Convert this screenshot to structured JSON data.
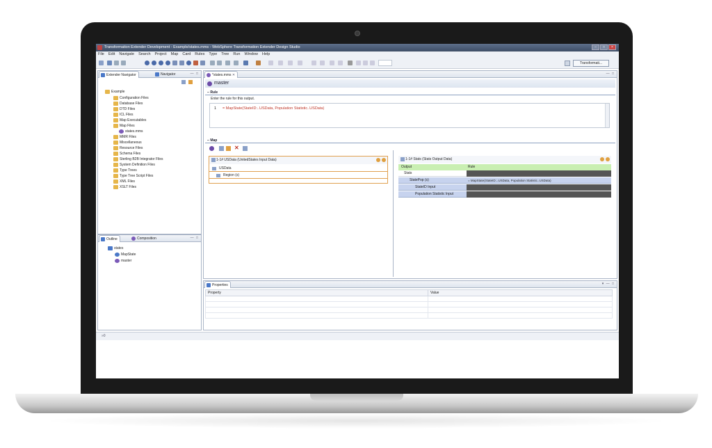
{
  "window": {
    "title": "Transformation Extender Development - Example/states.mms - WebSphere Transformation Extender Design Studio"
  },
  "menu": [
    "File",
    "Edit",
    "Navigate",
    "Search",
    "Project",
    "Map",
    "Card",
    "Rules",
    "Type",
    "Tree",
    "Run",
    "Window",
    "Help"
  ],
  "toolbar": {
    "perspective_label": "Transformati..."
  },
  "navigator": {
    "tabs": [
      "Extender Navigator",
      "Navigator"
    ],
    "root": "Example",
    "items": [
      "Configuration Files",
      "Database Files",
      "DTD Files",
      "ICL Files",
      "Map Executables",
      "Map Files",
      "states.mms",
      "MMR Files",
      "Miscellaneous",
      "Resource Files",
      "Schema Files",
      "Sterling B2B Integrator Files",
      "System Definition Files",
      "Type Trees",
      "Type Tree Script Files",
      "XML Files",
      "XSLT Files"
    ]
  },
  "outline": {
    "tabs": [
      "Outline",
      "Composition"
    ],
    "root": "states",
    "items": [
      "MapState",
      "master"
    ]
  },
  "editor": {
    "tab": "*states.mms",
    "title": "master",
    "rule_section": "Rule",
    "rule_hint": "Enter the rule for this output.",
    "rule_line_no": "1",
    "rule_text": "= MapState(StateID:..USData, Population Statistic..USData)",
    "map_section": "Map",
    "input_card": {
      "title": "1-1# USData (UnitedStates Input Data)",
      "rows": [
        "USData",
        "Region (s)"
      ]
    },
    "output_card": {
      "title": "1-1# Stats (Stats Output Data)",
      "col_output": "Output",
      "col_rule": "Rule",
      "rows": [
        {
          "name": "Stats",
          "rule": ""
        },
        {
          "name": "StatePop (s)",
          "rule": "= MapState(StateID:..USData, Population Statistic..USData)"
        },
        {
          "name": "StateID Input",
          "rule": ""
        },
        {
          "name": "Population Statistic Input",
          "rule": ""
        }
      ]
    }
  },
  "properties": {
    "tab": "Properties",
    "col_property": "Property",
    "col_value": "Value"
  },
  "status": {
    "text": "»0"
  },
  "colors": {
    "titlebar": "#3e4d66",
    "chrome": "#eef1f6",
    "input_card_border": "#e0a050",
    "output_header": "#c9efb2",
    "selected_row": "#c7d3ee",
    "dark_cell": "#555555",
    "rule_function": "#c0392b",
    "rule_args": "#3a8a3a"
  }
}
